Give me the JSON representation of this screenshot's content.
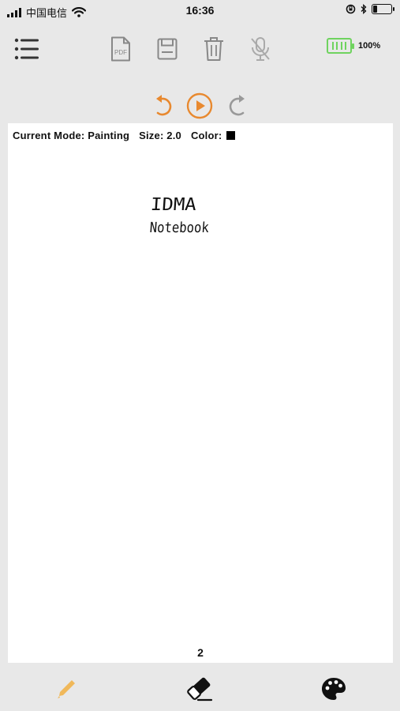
{
  "status_bar": {
    "carrier": "中国电信",
    "time": "16:36"
  },
  "toolbar": {
    "battery_level": "100%",
    "icons": [
      "menu-icon",
      "pdf-icon",
      "save-icon",
      "trash-icon",
      "mic-off-icon"
    ],
    "battery_color": "#6fd35f"
  },
  "playback": {
    "icons": [
      "undo-icon",
      "play-icon",
      "redo-icon"
    ],
    "accent_color": "#e8892f"
  },
  "canvas": {
    "mode_label": "Current Mode: Painting",
    "size_label": "Size: 2.0",
    "color_label": "Color:",
    "current_color": "#000000",
    "handwriting_line1": "IDMA",
    "handwriting_line2": "Notebook",
    "page_number": "2"
  },
  "tools": {
    "icons": [
      "pencil-icon",
      "eraser-icon",
      "palette-icon"
    ],
    "pencil_color": "#f0b85a"
  }
}
